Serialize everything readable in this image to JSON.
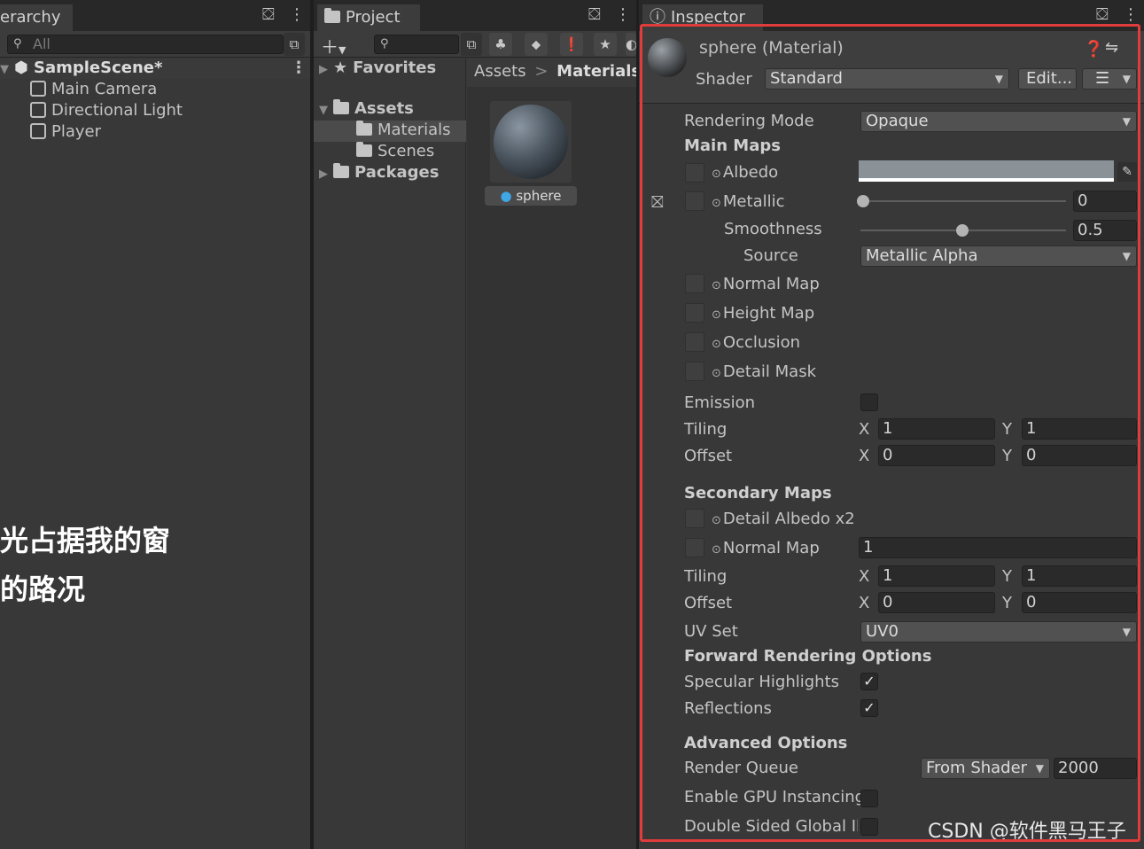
{
  "hierarchy": {
    "tab_label": "erarchy",
    "search_placeholder": "All",
    "scene_name": "SampleScene*",
    "objects": [
      "Main Camera",
      "Directional Light",
      "Player"
    ],
    "overlay_text_line1": "光占据我的窗",
    "overlay_text_line2": "的路况"
  },
  "project": {
    "tab_label": "Project",
    "tree": {
      "favorites": "Favorites",
      "assets": "Assets",
      "materials": "Materials",
      "scenes": "Scenes",
      "packages": "Packages"
    },
    "breadcrumb": {
      "root": "Assets",
      "separator": ">",
      "current": "Materials"
    },
    "asset_name": "sphere"
  },
  "inspector": {
    "tab_label": "Inspector",
    "title": "sphere (Material)",
    "shader_label": "Shader",
    "shader_value": "Standard",
    "edit_button": "Edit...",
    "rendering_mode_label": "Rendering Mode",
    "rendering_mode_value": "Opaque",
    "main_maps_title": "Main Maps",
    "albedo_label": "Albedo",
    "albedo_color": "#8a9297",
    "metallic_label": "Metallic",
    "metallic_value": "0",
    "smoothness_label": "Smoothness",
    "smoothness_value": "0.5",
    "source_label": "Source",
    "source_value": "Metallic Alpha",
    "normal_map_label": "Normal Map",
    "height_map_label": "Height Map",
    "occlusion_label": "Occlusion",
    "detail_mask_label": "Detail Mask",
    "emission_label": "Emission",
    "tiling_label": "Tiling",
    "offset_label": "Offset",
    "x_label": "X",
    "y_label": "Y",
    "main_tiling": {
      "x": "1",
      "y": "1"
    },
    "main_offset": {
      "x": "0",
      "y": "0"
    },
    "secondary_maps_title": "Secondary Maps",
    "detail_albedo_label": "Detail Albedo x2",
    "secondary_normal_label": "Normal Map",
    "secondary_normal_value": "1",
    "secondary_tiling": {
      "x": "1",
      "y": "1"
    },
    "secondary_offset": {
      "x": "0",
      "y": "0"
    },
    "uv_set_label": "UV Set",
    "uv_set_value": "UV0",
    "forward_title": "Forward Rendering Options",
    "specular_label": "Specular Highlights",
    "reflections_label": "Reflections",
    "advanced_title": "Advanced Options",
    "render_queue_label": "Render Queue",
    "render_queue_mode": "From Shader",
    "render_queue_value": "2000",
    "gpu_instancing_label": "Enable GPU Instancing",
    "double_sided_label": "Double Sided Global Illu",
    "watermark": "CSDN @软件黑马王子"
  },
  "colors": {
    "highlight_border": "#e03c3c",
    "selection": "#4b4b4b"
  }
}
